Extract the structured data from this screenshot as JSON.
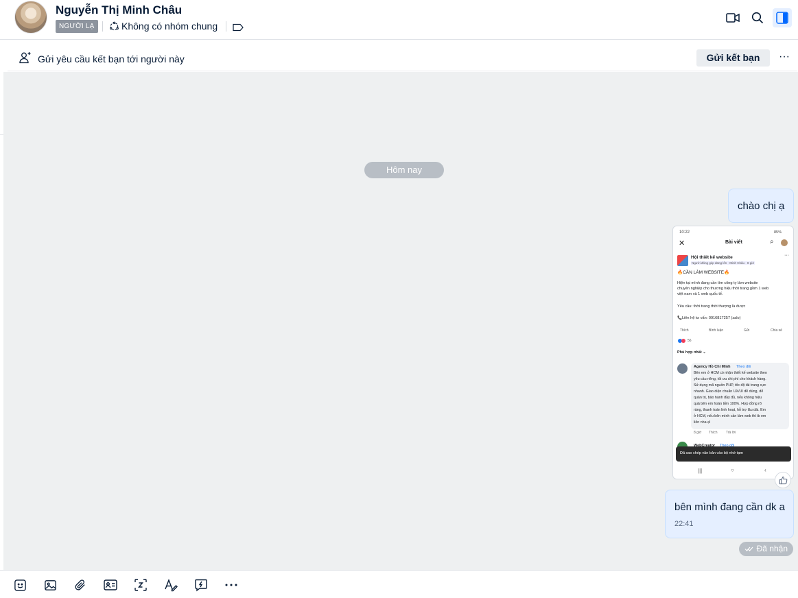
{
  "header": {
    "contact_name": "Nguyễn Thị Minh Châu",
    "stranger_badge": "NGƯỜI LẠ",
    "no_common_group": "Không có nhóm chung"
  },
  "friend_request_bar": {
    "text": "Gửi yêu cầu kết bạn tới người này",
    "button_label": "Gửi kết bạn",
    "more_label": "···"
  },
  "chat": {
    "date_separator": "Hôm nay",
    "messages": [
      {
        "text": "chào chị ạ"
      },
      {
        "text": "bên mình đang cần dk a",
        "time": "22:41"
      }
    ],
    "status": "Đã nhận"
  },
  "shared_image": {
    "status_time": "10:22",
    "battery": "85%",
    "title": "Bài viết",
    "group_name": "Hội thiết kế website",
    "post_meta": "Người đóng góp đang lên · Minh Châu · 8 giờ",
    "post_heading": "🔥CẦN LÀM WEBSITE🔥",
    "post_body_1": "Hiện tại mình đang cần tìm công ty làm website",
    "post_body_2": "chuyên nghiệp cho thương hiệu thời trang gồm 1 web",
    "post_body_3": "việt nam và 1 web quốc tế.",
    "post_req": "Yêu cầu: thời trang thời thượng là được",
    "post_contact": "📞Liên hệ tư vấn: 0916817257 (zalo)",
    "actions": [
      "Thích",
      "Bình luận",
      "Gửi",
      "Chia sẻ"
    ],
    "reaction_count": "56",
    "sort_label": "Phù hợp nhất ⌄",
    "comment_author": "Agency Hồ Chí Minh",
    "follow_label": "Theo dõi",
    "comment_lines": [
      "Bên em ở HCM có nhận thiết kế website theo",
      "yêu cầu riêng, tối ưu chi phí cho khách hàng.",
      "Sử dụng mã nguồn PHP, tốc độ tải trang cực",
      "nhanh. Giao diện chuẩn UX/UI dễ dùng, dễ",
      "quản trị, bảo hành đầy đủ, nếu không hiệu",
      "quả bên em hoàn tiền 100%. Hợp đồng rõ",
      "ràng, thanh toán linh hoạt, hỗ trợ lâu dài. Em",
      "ở HCM, nếu bên mình cần làm web thì ib em",
      "liên nha ạ!"
    ],
    "comment_meta": [
      "8 giờ",
      "Thích",
      "Trả lời"
    ],
    "second_author": "WebCreator",
    "toast": "Đã sao chép văn bản vào bộ nhớ tạm"
  },
  "toolbar": {
    "icons": [
      "sticker-icon",
      "image-icon",
      "attachment-icon",
      "contact-card-icon",
      "screenshot-icon",
      "text-format-icon",
      "quick-message-icon",
      "more-icon"
    ]
  },
  "colors": {
    "bubble_bg": "#e5efff",
    "chat_bg": "#eef0f1",
    "accent": "#0068ff",
    "pill_bg": "#b8bec5"
  }
}
